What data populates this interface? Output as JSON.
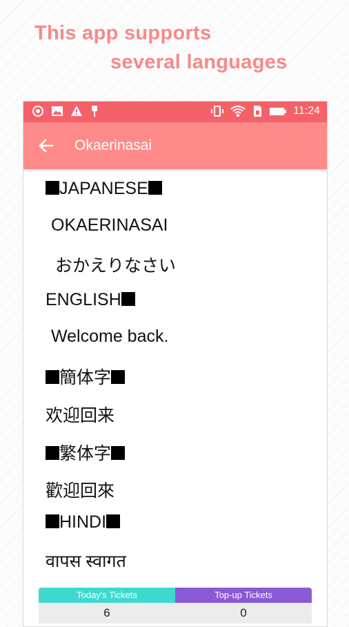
{
  "promo": {
    "line1": "This app supports",
    "line2": "several languages"
  },
  "statusbar": {
    "time": "11:24",
    "left_icons": [
      "app-notification-icon",
      "image-icon",
      "warning-icon",
      "usb-icon"
    ],
    "right_icons": [
      "vibrate-icon",
      "wifi-icon",
      "sim-icon",
      "battery-icon"
    ]
  },
  "appbar": {
    "title": "Okaerinasai",
    "back_icon": "arrow-left-icon"
  },
  "content": {
    "japanese_header": "JAPANESE",
    "japanese_romaji": "OKAERINASAI",
    "japanese_kana": "おかえりなさい",
    "english_header": "ENGLISH",
    "english_text": "Welcome back.",
    "simplified_header": "簡体字",
    "simplified_text": "欢迎回来",
    "traditional_header": "繁体字",
    "traditional_text": "歡迎回來",
    "hindi_header": "HINDI",
    "hindi_text": "वापस स्वागत"
  },
  "tickets": {
    "todays_label": "Today's Tickets",
    "topup_label": "Top-up Tickets",
    "todays_value": "6",
    "topup_value": "0"
  },
  "colors": {
    "statusbar": "#f56169",
    "appbar": "#ff8a8a",
    "promo_text": "#f58a8a",
    "tickets_today": "#3fd8cf",
    "tickets_topup": "#8a5ad6"
  }
}
